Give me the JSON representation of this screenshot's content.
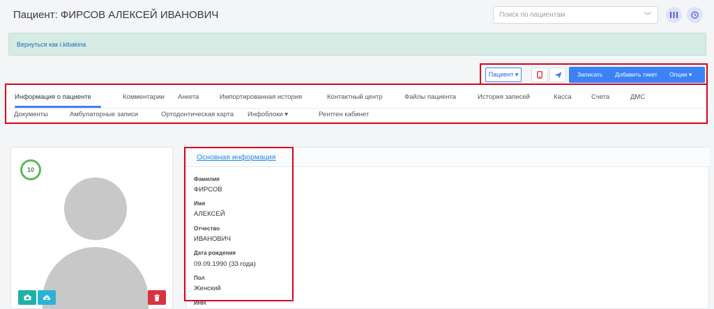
{
  "header": {
    "title": "Пациент: ФИРСОВ АЛЕКСЕЙ ИВАНОВИЧ",
    "search_placeholder": "Поиск по пациентам"
  },
  "banner": {
    "back_link": "Вернуться как i.kibakina"
  },
  "actions": {
    "patient": "Пациент ▾",
    "record": "Записать",
    "add_ticket": "Добавить тикет",
    "options": "Опции ▾"
  },
  "tabs": {
    "row1": [
      "Информация о пациенте",
      "Комментарии",
      "Анкета",
      "Импортированная история",
      "Контактный центр",
      "Файлы пациента",
      "История записей",
      "Касса",
      "Счета",
      "ДМС"
    ],
    "row2": [
      "Документы",
      "Амбулаторные записи",
      "Ортодонтическая карта",
      "Инфоблоки ▾",
      "Рентген кабинет"
    ],
    "active": "Информация о пациенте"
  },
  "avatar": {
    "badge_count": "10"
  },
  "info": {
    "section_title": "Основная информация",
    "fields": [
      {
        "label": "Фамилия",
        "value": "ФИРСОВ"
      },
      {
        "label": "Имя",
        "value": "АЛЕКСЕЙ"
      },
      {
        "label": "Отчество",
        "value": "ИВАНОВИЧ"
      },
      {
        "label": "Дата рождения",
        "value": "09.09.1990 (33 года)"
      },
      {
        "label": "Пол",
        "value": "Женский"
      },
      {
        "label": "ИНН",
        "value": ""
      }
    ]
  },
  "colors": {
    "accent": "#3b82f6",
    "highlight": "#d9001b",
    "banner": "#d5ebe3",
    "success": "#5cb85c",
    "danger": "#d9333f"
  }
}
